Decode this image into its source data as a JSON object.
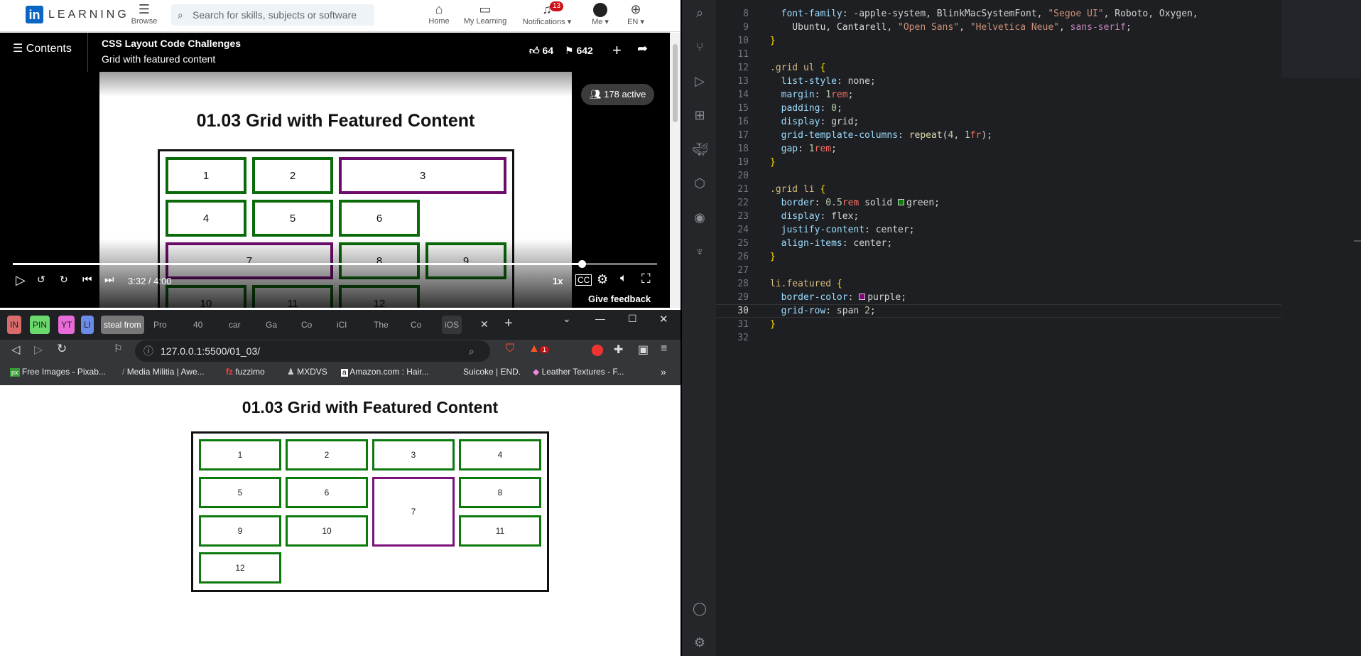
{
  "linkedin": {
    "logo": "in",
    "wordmark": "LEARNING",
    "browse": "Browse",
    "search_placeholder": "Search for skills, subjects or software",
    "nav": [
      {
        "label": "Home",
        "icon": "home-icon"
      },
      {
        "label": "My Learning",
        "icon": "book-icon"
      },
      {
        "label": "Notifications",
        "icon": "bell-icon",
        "badge": "13"
      },
      {
        "label": "Me",
        "icon": "avatar-icon"
      },
      {
        "label": "EN",
        "icon": "globe-icon"
      }
    ]
  },
  "video": {
    "contents": "Contents",
    "course_title": "CSS Layout Code Challenges",
    "lesson_title": "Grid with featured content",
    "likes": "64",
    "saves": "642",
    "active": "178 active",
    "slide_title": "01.03 Grid with Featured Content",
    "slide_cells": [
      "1",
      "2",
      "3",
      "4",
      "5",
      "6",
      "7",
      "8",
      "9",
      "10",
      "11",
      "12"
    ],
    "time": "3:32 / 4:00",
    "progress_fraction": 0.883,
    "speed": "1x",
    "feedback": "Give feedback"
  },
  "browser": {
    "tabs": [
      "IN",
      "PIN",
      "YT",
      "LI",
      "steal from",
      "Pro",
      "40",
      "car",
      "Ga",
      "Co",
      "iCl",
      "The",
      "Co",
      "iOS"
    ],
    "url": "127.0.0.1:5500/01_03/",
    "bookmarks": [
      "Free Images - Pixab...",
      "Media Militia | Awe...",
      "fuzzimo",
      "MXDVS",
      "Amazon.com : Hair...",
      "Suicoke | END.",
      "Leather Textures - F..."
    ],
    "brave_badge": "1"
  },
  "page": {
    "title": "01.03 Grid with Featured Content",
    "cells": [
      "1",
      "2",
      "3",
      "4",
      "5",
      "6",
      "7",
      "8",
      "9",
      "10",
      "11",
      "12"
    ]
  },
  "editor": {
    "lines": [
      {
        "n": "8",
        "t": "font-family: -apple-system, BlinkMacSystemFont, \"Segoe UI\", Roboto, Oxygen,"
      },
      {
        "n": "9",
        "t": "  Ubuntu, Cantarell, \"Open Sans\", \"Helvetica Neue\", sans-serif;"
      },
      {
        "n": "10",
        "t": "}"
      },
      {
        "n": "11",
        "t": ""
      },
      {
        "n": "12",
        "t": ".grid ul {"
      },
      {
        "n": "13",
        "t": "list-style: none;"
      },
      {
        "n": "14",
        "t": "margin: 1rem;"
      },
      {
        "n": "15",
        "t": "padding: 0;"
      },
      {
        "n": "16",
        "t": "display: grid;"
      },
      {
        "n": "17",
        "t": "grid-template-columns: repeat(4, 1fr);"
      },
      {
        "n": "18",
        "t": "gap: 1rem;"
      },
      {
        "n": "19",
        "t": "}"
      },
      {
        "n": "20",
        "t": ""
      },
      {
        "n": "21",
        "t": ".grid li {"
      },
      {
        "n": "22",
        "t": "border: 0.5rem solid green;"
      },
      {
        "n": "23",
        "t": "display: flex;"
      },
      {
        "n": "24",
        "t": "justify-content: center;"
      },
      {
        "n": "25",
        "t": "align-items: center;"
      },
      {
        "n": "26",
        "t": "}"
      },
      {
        "n": "27",
        "t": ""
      },
      {
        "n": "28",
        "t": "li.featured {"
      },
      {
        "n": "29",
        "t": "border-color: purple;"
      },
      {
        "n": "30",
        "t": "grid-row: span 2;"
      },
      {
        "n": "31",
        "t": "}"
      },
      {
        "n": "32",
        "t": ""
      }
    ],
    "current_line": "30"
  }
}
